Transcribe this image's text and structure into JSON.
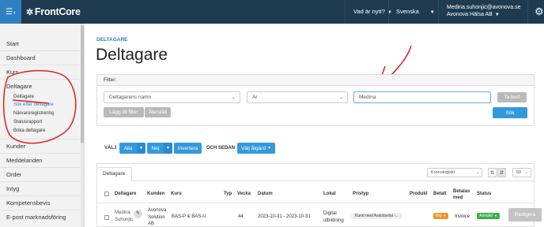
{
  "topbar": {
    "menu_icon": "hamburger-icon",
    "logo": "FrontCore",
    "news": "Vad är nytt?",
    "language": "Svenska",
    "user_email": "Medina.suhonjic@avonova.se",
    "user_org": "Avonova Hälsa AB",
    "gear_icon": "gear-icon",
    "bg_color": "#1e3b50",
    "accent_color": "#2f7fc4"
  },
  "sidebar": {
    "items": [
      {
        "label": "Start"
      },
      {
        "label": "Dashboard"
      },
      {
        "label": "Kurs"
      },
      {
        "label": "Deltagare"
      },
      {
        "label": "Kunder"
      },
      {
        "label": "Meddelanden"
      },
      {
        "label": "Order"
      },
      {
        "label": "Intyg"
      },
      {
        "label": "Kompetensbevis"
      },
      {
        "label": "E-post marknadsföring"
      }
    ],
    "subitems": [
      {
        "label": "Deltagare"
      },
      {
        "label": "Sök efter deltagare"
      },
      {
        "label": "Närvaroregistrering"
      },
      {
        "label": "Statusrapport"
      },
      {
        "label": "Boka deltagare"
      }
    ]
  },
  "page": {
    "breadcrumb": "DELTAGARE",
    "title": "Deltagare"
  },
  "filter": {
    "heading": "Filter:",
    "field_select": "Deltagarens namn",
    "operator_select": "Är",
    "value": "Medina",
    "remove_button": "Ta bort",
    "add_filter_button": "Lägg till filter",
    "reset_button": "Återställ",
    "search_button": "Sök"
  },
  "actions": {
    "choose_label": "VÄLJ",
    "all_button": "Alla",
    "none_button": "Nej",
    "invert_button": "Invertera",
    "then_label": "OCH SEDAN",
    "action_button": "Välj åtgärd"
  },
  "table": {
    "tab": "Deltagare",
    "sort_select": "Kronologiskt",
    "page_size": "50",
    "columns": [
      "Deltagare",
      "Kunden",
      "Kurs",
      "Typ",
      "Vecka",
      "Datum",
      "Lokal",
      "Pristyp",
      "Produkt",
      "Betalt",
      "Betalas med",
      "Status"
    ],
    "rows": [
      {
        "participant_first": "Medina",
        "participant_last": "Suhonjic",
        "customer": "Avonova Solution AB",
        "course": "BAS-P & BAS-U",
        "week": "44",
        "date": "2023-10-31 - 2023-10-31",
        "location": "Digital utbildning",
        "price_type": "Kund med Assistavtal -...",
        "paid": "Nej",
        "pay_method": "Invoice",
        "status": "Anmäld",
        "edit_button": "Redigera"
      }
    ]
  }
}
